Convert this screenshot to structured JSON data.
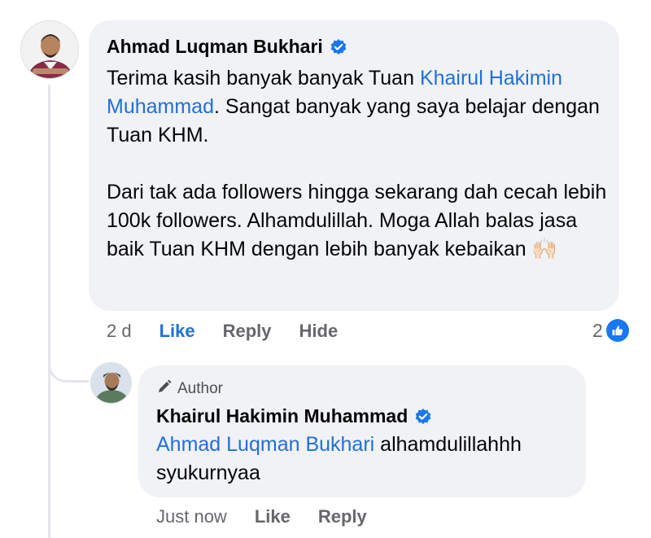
{
  "comment": {
    "author": "Ahmad Luqman Bukhari",
    "text_before_mention": "Terima kasih banyak banyak Tuan ",
    "mention": "Khairul Hakimin Muhammad",
    "text_after_mention": ". Sangat banyak yang saya belajar dengan Tuan KHM.",
    "paragraph_2": "Dari tak ada followers hingga sekarang dah cecah lebih 100k followers. Alhamdulillah. Moga Allah balas jasa baik Tuan KHM dengan lebih banyak kebaikan ",
    "emoji": "🙌🏻",
    "time": "2 d",
    "like_label": "Like",
    "reply_label": "Reply",
    "hide_label": "Hide",
    "reaction_count": "2"
  },
  "reply": {
    "badge_label": "Author",
    "author": "Khairul Hakimin Muhammad",
    "mention": "Ahmad Luqman Bukhari",
    "text": " alhamdulillahhh syukurnyaa",
    "time": "Just now",
    "like_label": "Like",
    "reply_label": "Reply"
  },
  "colors": {
    "bubble_bg": "#f0f2f5",
    "mention": "#216fdb",
    "meta_text": "#65676b",
    "verified": "#1877f2"
  },
  "icons": [
    "verified-badge-icon",
    "author-pen-icon",
    "like-thumb-icon"
  ]
}
